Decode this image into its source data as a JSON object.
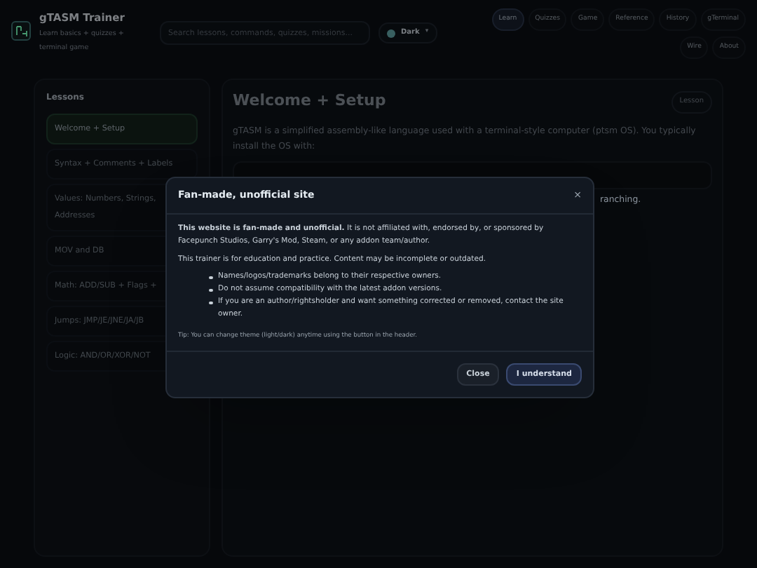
{
  "header": {
    "title": "gTASM Trainer",
    "subtitle": "Learn basics + quizzes + terminal game",
    "search": {
      "placeholder": "Search lessons, commands, quizzes, missions..."
    },
    "theme": {
      "label": "Dark",
      "caret": "▾"
    },
    "nav": [
      {
        "label": "Learn",
        "selected": true
      },
      {
        "label": "Quizzes",
        "selected": false
      },
      {
        "label": "Game",
        "selected": false
      },
      {
        "label": "Reference",
        "selected": false
      },
      {
        "label": "History",
        "selected": false
      },
      {
        "label": "gTerminal",
        "selected": false
      },
      {
        "label": "Wire",
        "selected": false
      },
      {
        "label": "About",
        "selected": false
      }
    ]
  },
  "sidebar": {
    "title": "Lessons",
    "items": [
      {
        "label": "Welcome + Setup",
        "selected": true
      },
      {
        "label": "Syntax + Comments + Labels",
        "selected": false
      },
      {
        "label": "Values: Numbers, Strings, Addresses",
        "selected": false
      },
      {
        "label": "MOV and DB",
        "selected": false
      },
      {
        "label": "Math: ADD/SUB + Flags +",
        "selected": false
      },
      {
        "label": "Jumps: JMP/JE/JNE/JA/JB",
        "selected": false
      },
      {
        "label": "Logic: AND/OR/XOR/NOT",
        "selected": false
      }
    ]
  },
  "lesson": {
    "title": "Welcome + Setup",
    "badge": "Lesson",
    "intro": "gTASM is a simplified assembly-like language used with a terminal-style computer (ptsm OS). You typically install the OS with:",
    "fragment": "ranching."
  },
  "dialog": {
    "title": "Fan-made, unofficial site",
    "close": "×",
    "paragraphs": [
      "**This website is fan-made and unofficial.** It is not affiliated with, endorsed by, or sponsored by Facepunch Studios, Garry's Mod, Steam, or any addon team/author.",
      "This trainer is for education and practice. Content may be incomplete or outdated."
    ],
    "bullets": [
      "Names/logos/trademarks belong to their respective owners.",
      "Do not assume compatibility with the latest addon versions.",
      "If you are an author/rightsholder and want something corrected or removed, contact the site owner."
    ],
    "tip": "Tip: You can change theme (light/dark) anytime using the button in the header.",
    "buttons": [
      "Close",
      "I understand"
    ]
  }
}
